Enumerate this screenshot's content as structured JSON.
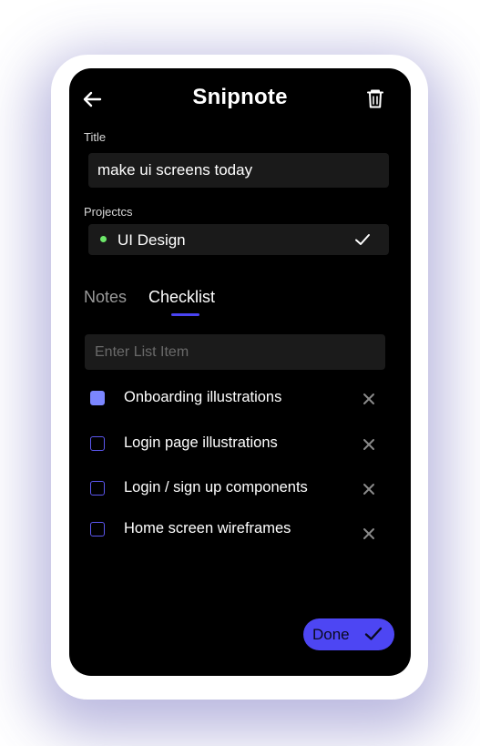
{
  "app": {
    "title": "Snipnote"
  },
  "form": {
    "title_label": "Title",
    "title_value": "make ui screens today",
    "projects_label": "Projectcs",
    "selected_project": "UI Design"
  },
  "tabs": [
    {
      "label": "Notes",
      "active": false
    },
    {
      "label": "Checklist",
      "active": true
    }
  ],
  "checklist": {
    "input_placeholder": "Enter List Item",
    "items": [
      {
        "label": "Onboarding illustrations",
        "checked": true
      },
      {
        "label": "Login page illustrations",
        "checked": false
      },
      {
        "label": "Login / sign up components",
        "checked": false
      },
      {
        "label": "Home screen wireframes",
        "checked": false
      }
    ]
  },
  "actions": {
    "done_label": "Done"
  },
  "icons": {
    "back": "arrow-left-icon",
    "delete": "trash-icon",
    "project_status": "dot-icon",
    "project_selected": "check-icon",
    "remove_item": "close-icon",
    "done": "check-icon"
  },
  "colors": {
    "background": "#000000",
    "accent": "#4d46f3",
    "checked_box": "#7b86ff",
    "project_dot": "#6de86a",
    "field_background": "#1a1a1a"
  }
}
